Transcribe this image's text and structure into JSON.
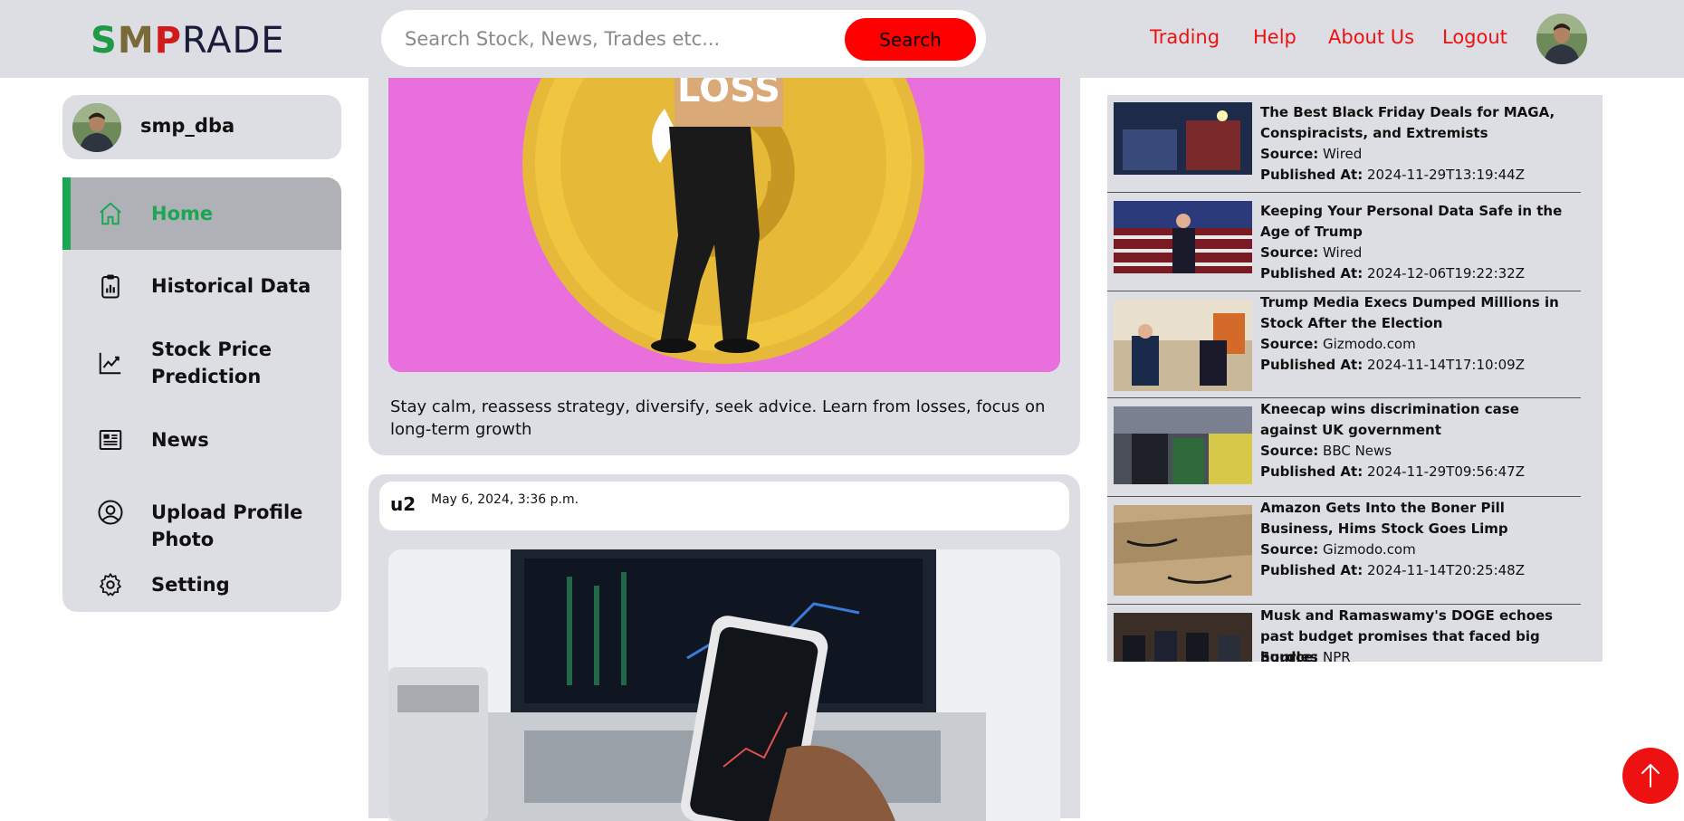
{
  "header": {
    "logo": {
      "s": "S",
      "m": "M",
      "p": "P",
      "rest": "RADE"
    },
    "search": {
      "placeholder": "Search Stock, News, Trades etc...",
      "button": "Search"
    },
    "nav": [
      "Trading",
      "Help",
      "About Us",
      "Logout"
    ]
  },
  "sidebar": {
    "username": "smp_dba",
    "items": [
      {
        "label": "Home",
        "icon": "home-icon",
        "active": true
      },
      {
        "label": "Historical Data",
        "icon": "clipboard-chart-icon"
      },
      {
        "label": "Stock Price Prediction",
        "icon": "trend-chart-icon"
      },
      {
        "label": "News",
        "icon": "newspaper-icon"
      },
      {
        "label": "Upload Profile Photo",
        "icon": "user-circle-icon"
      },
      {
        "label": "Setting",
        "icon": "gear-icon"
      }
    ]
  },
  "feed": {
    "post1": {
      "image_text": "LOSS",
      "caption": "Stay calm, reassess strategy, diversify, seek advice. Learn from losses, focus on long-term growth"
    },
    "post2": {
      "user": "u2",
      "date": "May 6, 2024, 3:36 p.m."
    }
  },
  "news": {
    "source_label": "Source:",
    "published_label": "Published At:",
    "items": [
      {
        "title": "The Best Black Friday Deals for MAGA, Conspiracists, and Extremists",
        "source": "Wired",
        "published": "2024-11-29T13:19:44Z"
      },
      {
        "title": "Keeping Your Personal Data Safe in the Age of Trump",
        "source": "Wired",
        "published": "2024-12-06T19:22:32Z"
      },
      {
        "title": "Trump Media Execs Dumped Millions in Stock After the Election",
        "source": "Gizmodo.com",
        "published": "2024-11-14T17:10:09Z"
      },
      {
        "title": "Kneecap wins discrimination case against UK government",
        "source": "BBC News",
        "published": "2024-11-29T09:56:47Z"
      },
      {
        "title": "Amazon Gets Into the Boner Pill Business, Hims Stock Goes Limp",
        "source": "Gizmodo.com",
        "published": "2024-11-14T20:25:48Z"
      },
      {
        "title": "Musk and Ramaswamy's DOGE echoes past budget promises that faced big hurdles",
        "source": "NPR",
        "published": ""
      }
    ]
  },
  "colors": {
    "accent_red": "#ff0000",
    "active_green": "#1aa653",
    "panel_grey": "#dcdee3"
  }
}
